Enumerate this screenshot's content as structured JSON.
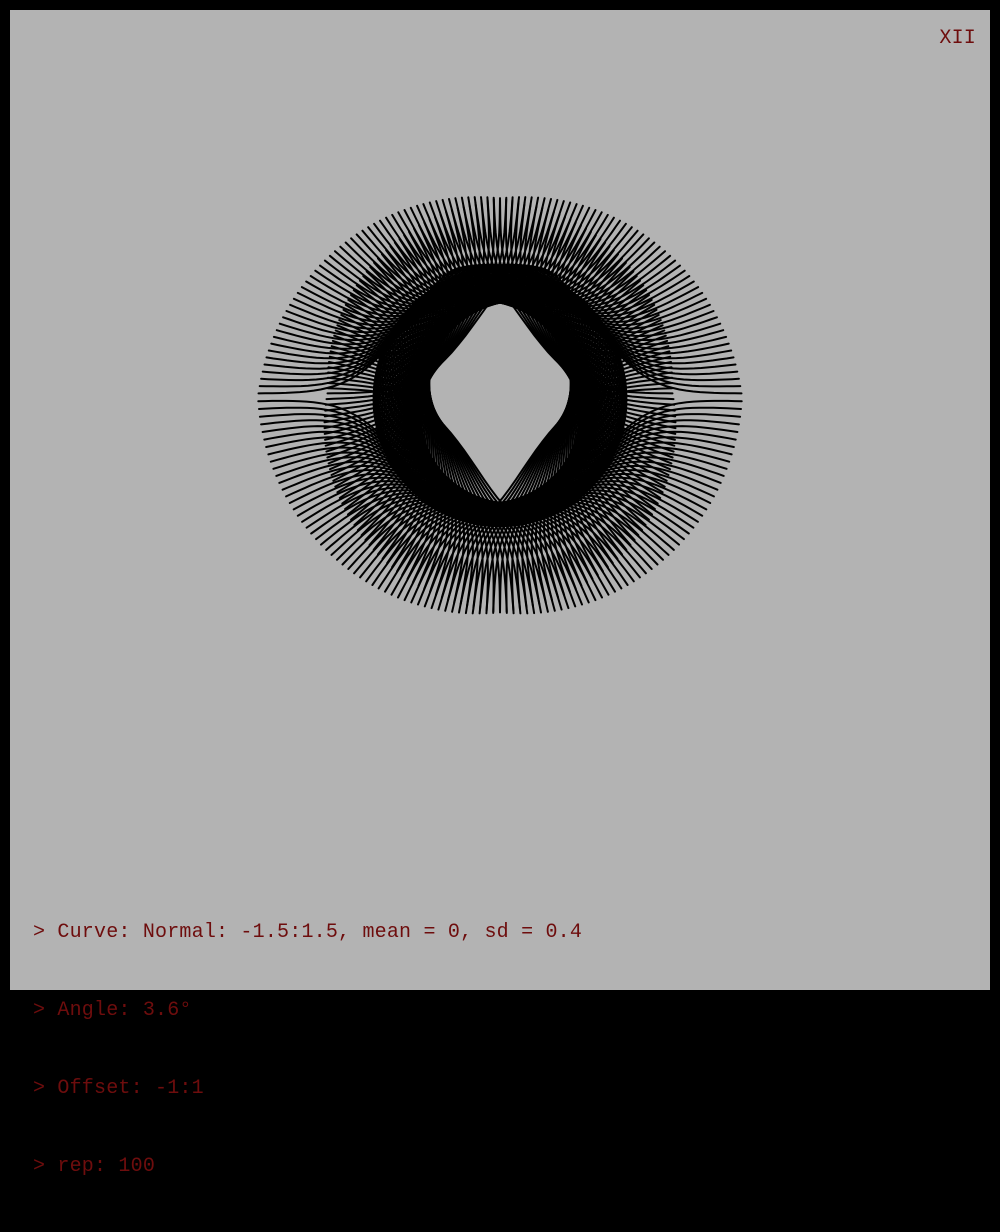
{
  "plate_number": "XII",
  "log": [
    "> Curve: Normal: -1.5:1.5, mean = 0, sd = 0.4",
    "> Angle: 3.6°",
    "> Offset: -1:1",
    "> rep: 100"
  ],
  "params": {
    "curve": "Normal",
    "domain": [
      -1.5,
      1.5
    ],
    "mean": 0,
    "sd": 0.4,
    "angle_deg": 3.6,
    "offset": [
      -1,
      1
    ],
    "rep": 100
  },
  "colors": {
    "frame": "#000000",
    "background": "#b3b3b3",
    "text": "#6e0d0d",
    "stroke": "#000000"
  }
}
